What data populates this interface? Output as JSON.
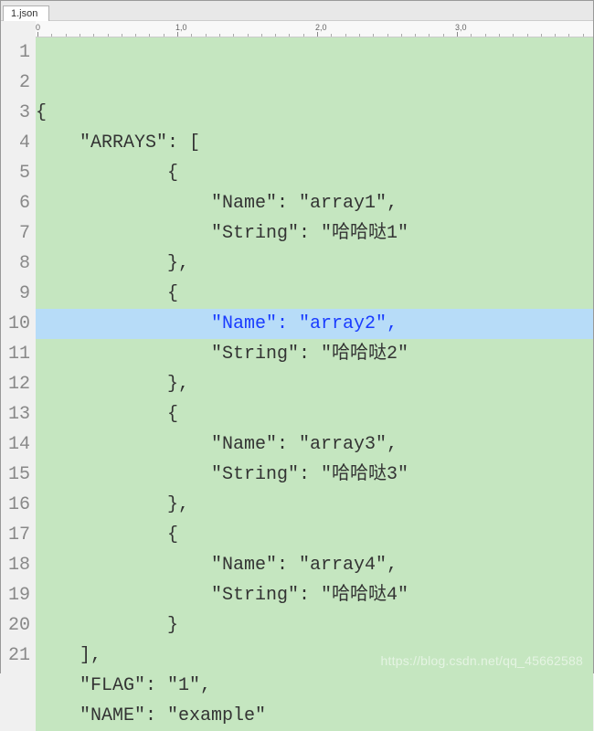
{
  "tab": {
    "label": "1.json"
  },
  "ruler": {
    "marks": [
      "0",
      "1,0",
      "2,0",
      "3,0"
    ]
  },
  "highlightLine": 8,
  "lines": [
    {
      "n": "1",
      "text": "{"
    },
    {
      "n": "2",
      "text": "    \"ARRAYS\": ["
    },
    {
      "n": "3",
      "text": "            {"
    },
    {
      "n": "4",
      "text": "                \"Name\": \"array1\","
    },
    {
      "n": "5",
      "text": "                \"String\": \"哈哈哒1\""
    },
    {
      "n": "6",
      "text": "            },"
    },
    {
      "n": "7",
      "text": "            {"
    },
    {
      "n": "8",
      "text": "                \"Name\": \"array2\","
    },
    {
      "n": "9",
      "text": "                \"String\": \"哈哈哒2\""
    },
    {
      "n": "10",
      "text": "            },"
    },
    {
      "n": "11",
      "text": "            {"
    },
    {
      "n": "12",
      "text": "                \"Name\": \"array3\","
    },
    {
      "n": "13",
      "text": "                \"String\": \"哈哈哒3\""
    },
    {
      "n": "14",
      "text": "            },"
    },
    {
      "n": "15",
      "text": "            {"
    },
    {
      "n": "16",
      "text": "                \"Name\": \"array4\","
    },
    {
      "n": "17",
      "text": "                \"String\": \"哈哈哒4\""
    },
    {
      "n": "18",
      "text": "            }"
    },
    {
      "n": "19",
      "text": "    ],"
    },
    {
      "n": "20",
      "text": "    \"FLAG\": \"1\","
    },
    {
      "n": "21",
      "text": "    \"NAME\": \"example\""
    }
  ],
  "watermark": "https://blog.csdn.net/qq_45662588"
}
